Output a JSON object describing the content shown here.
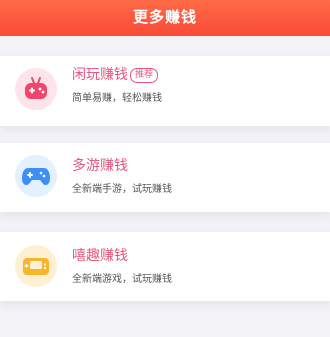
{
  "header": {
    "title": "更多赚钱"
  },
  "cards": [
    {
      "title": "闲玩赚钱",
      "badge": "推荐",
      "subtitle": "简单易赚，轻松赚钱",
      "icon": "red-game-controller-icon",
      "icon_bg": "#ffe3ea",
      "icon_color": "#f2456e"
    },
    {
      "title": "多游赚钱",
      "subtitle": "全新端手游，试玩赚钱",
      "icon": "blue-gamepad-icon",
      "icon_bg": "#e2f0ff",
      "icon_color": "#3f8ef5"
    },
    {
      "title": "嘻趣赚钱",
      "subtitle": "全新端游戏，试玩赚钱",
      "icon": "yellow-handheld-console-icon",
      "icon_bg": "#fff0d4",
      "icon_color": "#f7b52c"
    }
  ],
  "colors": {
    "header_gradient_top": "#ff6b47",
    "header_gradient_bottom": "#f94a36",
    "title_pink": "#e8567d",
    "background": "#f3f2f6"
  }
}
